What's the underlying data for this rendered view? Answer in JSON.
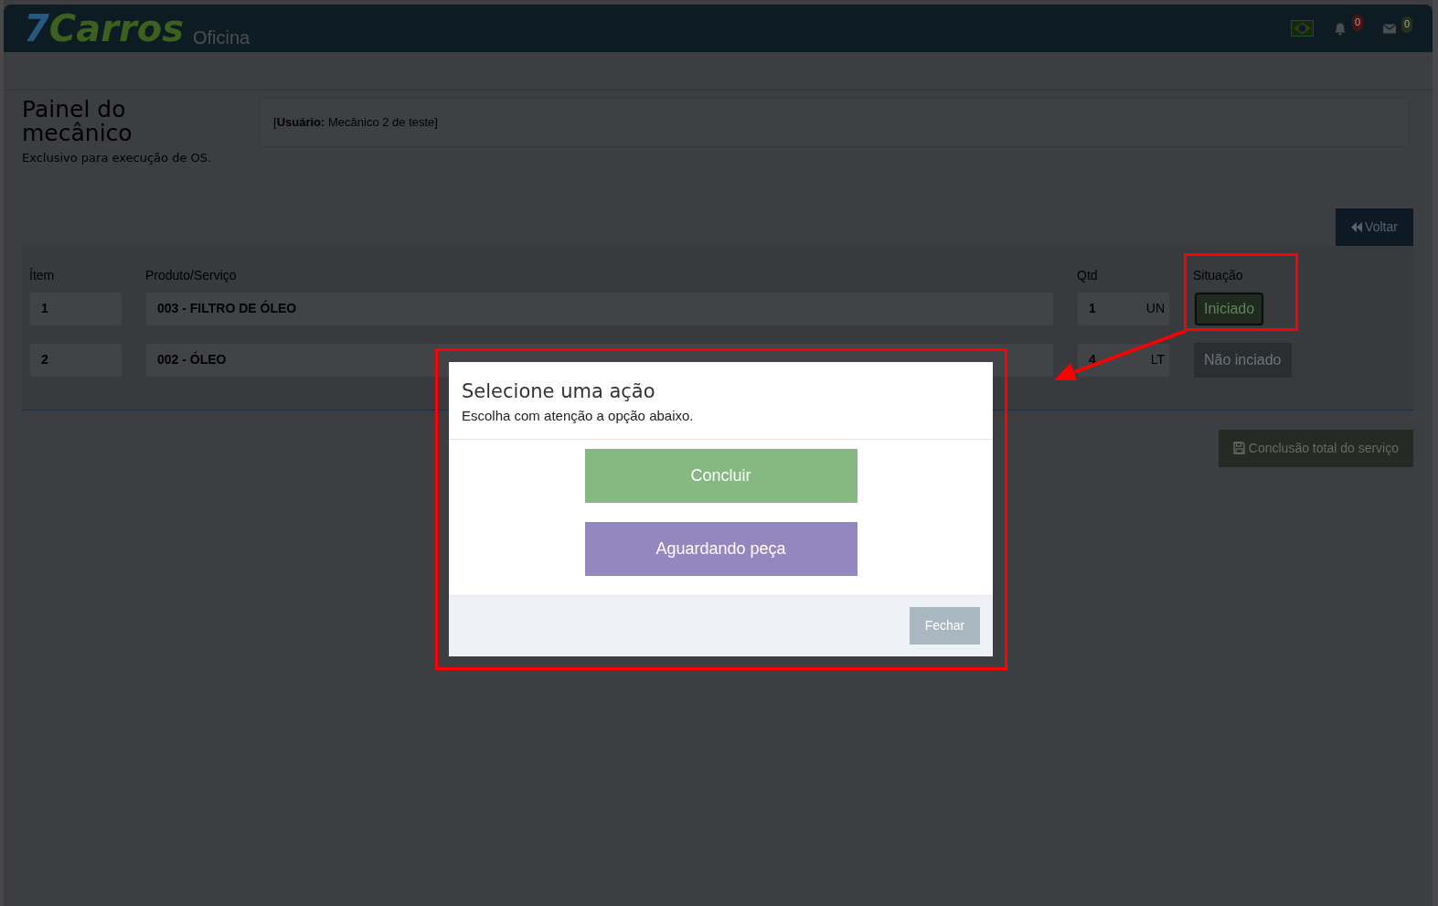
{
  "header": {
    "logo": {
      "number": "7",
      "name": "Carros",
      "suffix": "Oficina"
    },
    "notifications": [
      {
        "kind": "bell",
        "count": "0",
        "color": "#4a1412"
      },
      {
        "kind": "mail",
        "count": "0",
        "color": "#27301a"
      }
    ]
  },
  "page": {
    "title": "Painel do mecânico",
    "subtitle": "Exclusivo para execução de OS.",
    "user_info": "[**Usuário:** Mecânico 2 de teste]"
  },
  "back_button": "Voltar",
  "items_table": {
    "columns": [
      "Ítem",
      "Produto/Serviço",
      "Qtd",
      "Situação"
    ],
    "rows": [
      {
        "item": "1",
        "product": "003 - FILTRO DE ÓLEO",
        "quantity": "1",
        "unit": "UN",
        "status": "Iniciado",
        "kind": "started"
      },
      {
        "item": "2",
        "product": "002 - ÓLEO",
        "quantity": "4",
        "unit": "LT",
        "status": "Não inciado",
        "kind": "not_started"
      }
    ]
  },
  "complete_button": "Conclusão total do serviço",
  "modal": {
    "title": "Selecione uma ação",
    "subtitle": "Escolha com atenção a opção abaixo.",
    "actions": [
      {
        "label": "Concluir",
        "color": "#86b882"
      },
      {
        "label": "Aguardando peça",
        "color": "#9486be"
      }
    ],
    "close_button": "Fechar"
  }
}
